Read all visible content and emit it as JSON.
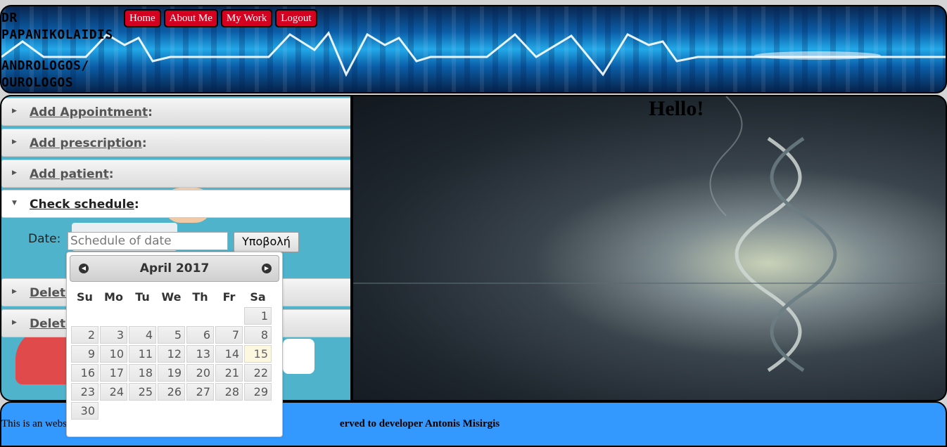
{
  "header": {
    "title_line1": "DR PAPANIKOLAIDIS",
    "title_line2": "ANDROLOGOS/ OUROLOGOS",
    "nav": [
      "Home",
      "About Me",
      "My Work",
      "Logout"
    ]
  },
  "accordion": {
    "items": [
      {
        "label": "Add Appointment",
        "suffix": ":",
        "expanded": false
      },
      {
        "label": "Add prescription",
        "suffix": ":",
        "expanded": false
      },
      {
        "label": "Add patient",
        "suffix": ":",
        "expanded": false
      },
      {
        "label": "Check schedule",
        "suffix": ":",
        "expanded": true
      },
      {
        "label": "Delete",
        "suffix": "",
        "expanded": false
      },
      {
        "label": "Delete",
        "suffix": "",
        "expanded": false
      }
    ],
    "schedule_form": {
      "date_label": "Date:",
      "date_placeholder": "Schedule of date",
      "submit_label": "Υποβολή"
    }
  },
  "main": {
    "greeting": "Hello!"
  },
  "datepicker": {
    "title": "April 2017",
    "prev_icon": "circle-triangle-left-icon",
    "next_icon": "circle-triangle-right-icon",
    "weekdays": [
      "Su",
      "Mo",
      "Tu",
      "We",
      "Th",
      "Fr",
      "Sa"
    ],
    "weeks": [
      [
        "",
        "",
        "",
        "",
        "",
        "",
        "1"
      ],
      [
        "2",
        "3",
        "4",
        "5",
        "6",
        "7",
        "8"
      ],
      [
        "9",
        "10",
        "11",
        "12",
        "13",
        "14",
        "15"
      ],
      [
        "16",
        "17",
        "18",
        "19",
        "20",
        "21",
        "22"
      ],
      [
        "23",
        "24",
        "25",
        "26",
        "27",
        "28",
        "29"
      ],
      [
        "30",
        "",
        "",
        "",
        "",
        "",
        ""
      ]
    ],
    "today": "15"
  },
  "footer": {
    "text_start": "This is an webs",
    "text_end": "erved to developer Antonis Misirgis"
  },
  "colors": {
    "nav_button": "#d40020",
    "footer": "#3399ff",
    "today_highlight": "#fcf8e0"
  }
}
